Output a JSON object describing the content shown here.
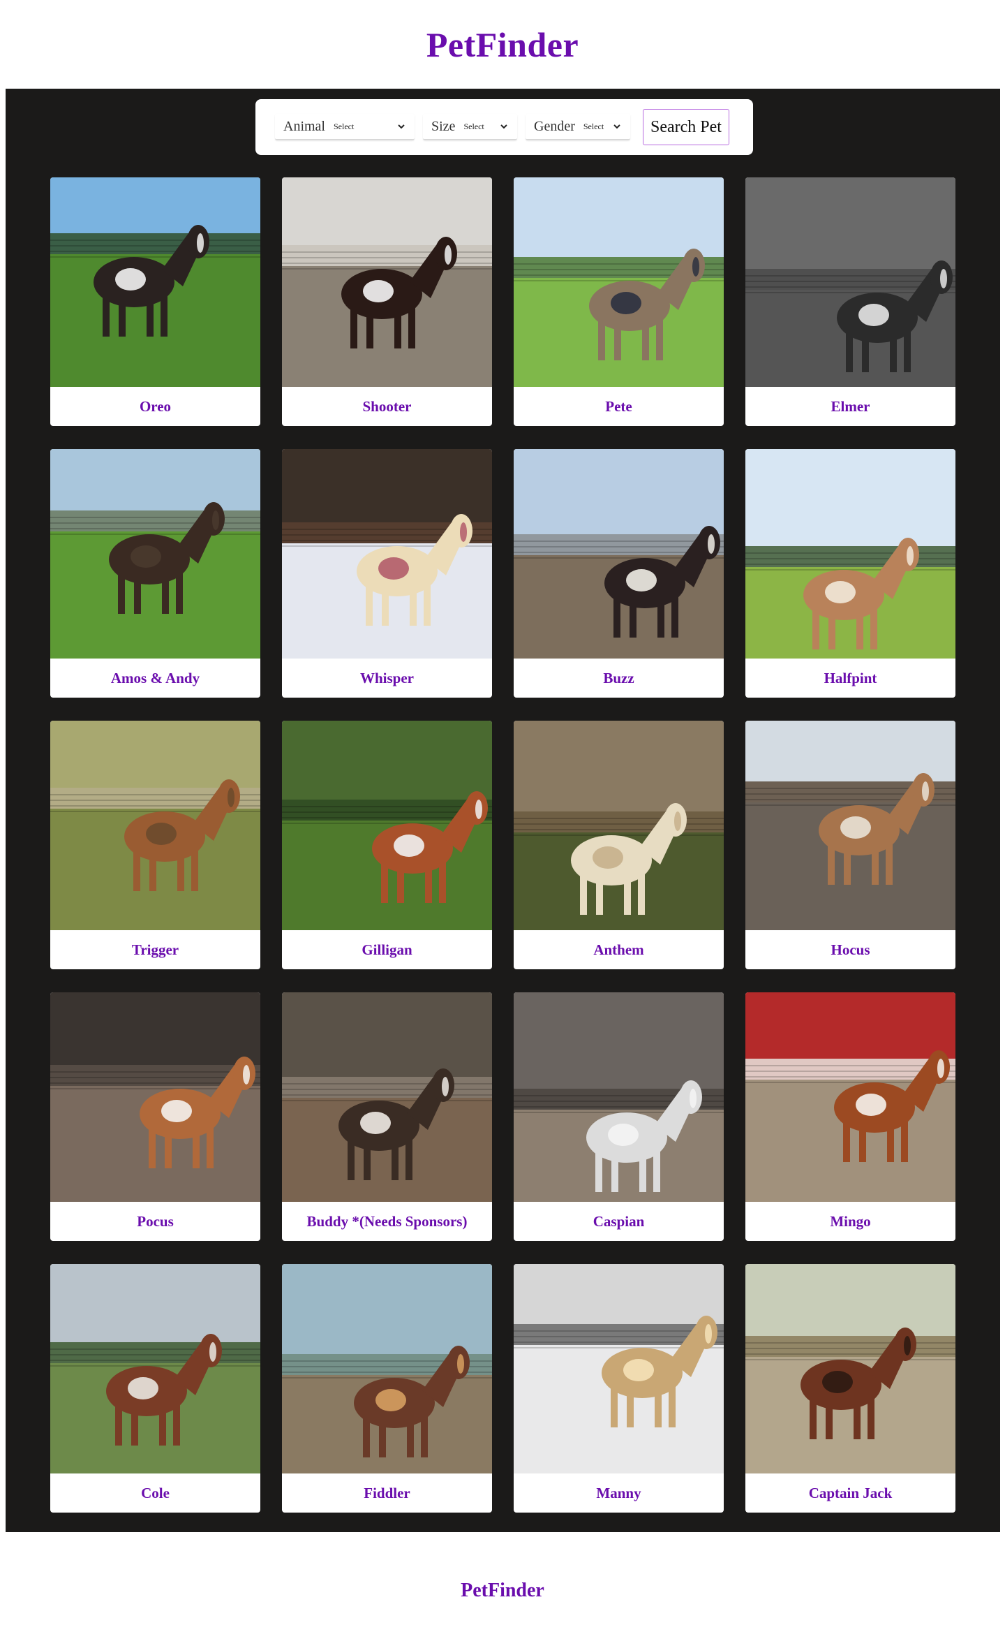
{
  "header": {
    "title": "PetFinder"
  },
  "search": {
    "animal_label": "Animal",
    "animal_value": "Select",
    "size_label": "Size",
    "size_value": "Select",
    "gender_label": "Gender",
    "gender_value": "Select",
    "button_label": "Search Pet",
    "chevron_icon": "chevron-down-icon"
  },
  "pets": [
    {
      "name": "Oreo",
      "sky": "#7ab3e0",
      "ground": "#4f8a2e",
      "animal": "#2a2220",
      "accent": "#f2f2f2",
      "bg": "#2f4f2a"
    },
    {
      "name": "Shooter",
      "sky": "#d8d6d2",
      "ground": "#8a8174",
      "animal": "#2a1a16",
      "accent": "#f5f5f5",
      "bg": "#c9c3bb"
    },
    {
      "name": "Pete",
      "sky": "#c8dcef",
      "ground": "#7fb84a",
      "animal": "#8a7560",
      "accent": "#2b3140",
      "bg": "#4e7a34"
    },
    {
      "name": "Elmer",
      "sky": "#6a6a6a",
      "ground": "#555555",
      "animal": "#2b2b2b",
      "accent": "#e6e6e6",
      "bg": "#4a4a4a"
    },
    {
      "name": "Amos & Andy",
      "sky": "#a9c6dc",
      "ground": "#5d9a34",
      "animal": "#3a2a22",
      "accent": "#4a3a2e",
      "bg": "#6b7a60"
    },
    {
      "name": "Whisper",
      "sky": "#3b3028",
      "ground": "#e4e7ef",
      "animal": "#ecdcb8",
      "accent": "#b35c6a",
      "bg": "#5a4030"
    },
    {
      "name": "Buzz",
      "sky": "#b8cde3",
      "ground": "#7d6e5c",
      "animal": "#2a2020",
      "accent": "#f0ede6",
      "bg": "#8a8e92"
    },
    {
      "name": "Halfpint",
      "sky": "#d7e6f3",
      "ground": "#8cb546",
      "animal": "#b9825a",
      "accent": "#f2e8d8",
      "bg": "#3f5a34"
    },
    {
      "name": "Trigger",
      "sky": "#a8a870",
      "ground": "#7e8a46",
      "animal": "#9a5c32",
      "accent": "#6b4a2c",
      "bg": "#b5ad8a"
    },
    {
      "name": "Gilligan",
      "sky": "#4a6a30",
      "ground": "#4f7a2c",
      "animal": "#a9512a",
      "accent": "#f1f1f1",
      "bg": "#2e4a22"
    },
    {
      "name": "Anthem",
      "sky": "#8a7a62",
      "ground": "#4e5a2e",
      "animal": "#e7dcc2",
      "accent": "#c7b08c",
      "bg": "#6a5a40"
    },
    {
      "name": "Hocus",
      "sky": "#d3dbe2",
      "ground": "#6a6158",
      "animal": "#a7744c",
      "accent": "#e9e2d6",
      "bg": "#5a4a3a"
    },
    {
      "name": "Pocus",
      "sky": "#3a3430",
      "ground": "#7a6a5e",
      "animal": "#b1693a",
      "accent": "#f5f2ee",
      "bg": "#5a5048"
    },
    {
      "name": "Buddy *(Needs Sponsors)",
      "sky": "#5a5248",
      "ground": "#7a6450",
      "animal": "#3a2c24",
      "accent": "#efeae4",
      "bg": "#8a7e72"
    },
    {
      "name": "Caspian",
      "sky": "#6a6460",
      "ground": "#8d7f70",
      "animal": "#dcdcdc",
      "accent": "#f4f4f4",
      "bg": "#4a4440"
    },
    {
      "name": "Mingo",
      "sky": "#b42a2a",
      "ground": "#a1917c",
      "animal": "#9c4a22",
      "accent": "#f6f2ec",
      "bg": "#e8e4de"
    },
    {
      "name": "Cole",
      "sky": "#b9c3cb",
      "ground": "#6d8a4a",
      "animal": "#7a3c26",
      "accent": "#e9e6e0",
      "bg": "#3c5a30"
    },
    {
      "name": "Fiddler",
      "sky": "#9bb8c6",
      "ground": "#8a7a62",
      "animal": "#6a3a28",
      "accent": "#d6a060",
      "bg": "#6e8a7e"
    },
    {
      "name": "Manny",
      "sky": "#d6d6d6",
      "ground": "#e9e9ea",
      "animal": "#c9a774",
      "accent": "#f5e2b8",
      "bg": "#6a6a6a"
    },
    {
      "name": "Captain Jack",
      "sky": "#c8cdb8",
      "ground": "#b3a68c",
      "animal": "#6e3420",
      "accent": "#2c1a12",
      "bg": "#8a7a58"
    }
  ],
  "footer": {
    "title": "PetFinder"
  }
}
